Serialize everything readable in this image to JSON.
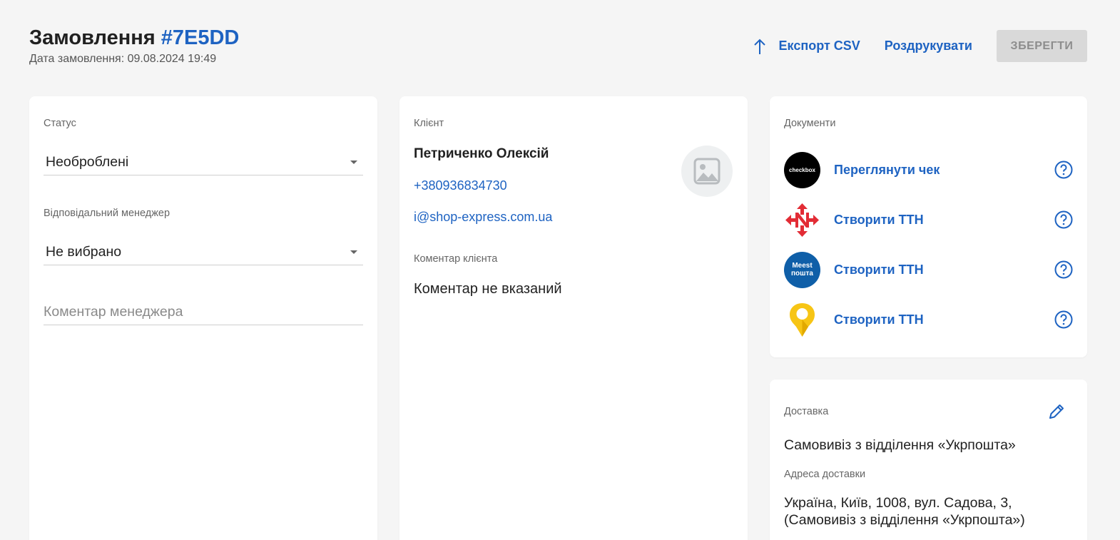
{
  "header": {
    "title_prefix": "Замовлення",
    "order_id": "#7E5DD",
    "order_date": "Дата замовлення: 09.08.2024 19:49"
  },
  "actions": {
    "export_label": "Експорт CSV",
    "print_label": "Роздрукувати",
    "save_label": "ЗБЕРЕГТИ"
  },
  "order": {
    "status_label": "Статус",
    "status_value": "Необроблені",
    "manager_label": "Відповідальний менеджер",
    "manager_value": "Не вибрано",
    "manager_comment_placeholder": "Коментар менеджера"
  },
  "client": {
    "section_label": "Клієнт",
    "name": "Петриченко Олексій",
    "phone": "+380936834730",
    "email": "i@shop-express.com.ua",
    "comment_label": "Коментар клієнта",
    "comment_value": "Коментар не вказаний"
  },
  "documents": {
    "section_label": "Документи",
    "items": [
      {
        "logo": "checkbox-logo",
        "logo_text": "checkbox",
        "label": "Переглянути чек"
      },
      {
        "logo": "nova-poshta-logo",
        "label": "Створити ТТН"
      },
      {
        "logo": "meest-logo",
        "logo_text_1": "Meest",
        "logo_text_2": "пошта",
        "label": "Створити ТТН"
      },
      {
        "logo": "ukrposhta-logo",
        "label": "Створити ТТН"
      }
    ]
  },
  "delivery": {
    "section_label": "Доставка",
    "method": "Самовивіз з відділення «Укрпошта»",
    "address_label": "Адреса доставки",
    "address_line1": "Україна, Київ, 1008, вул. Садова, 3,",
    "address_line2": "(Самовивіз з відділення «Укрпошта»)"
  },
  "colors": {
    "accent": "#1e63c2",
    "background": "#f5f5f5",
    "card": "#ffffff",
    "disabled_button": "#d9d9d9"
  }
}
